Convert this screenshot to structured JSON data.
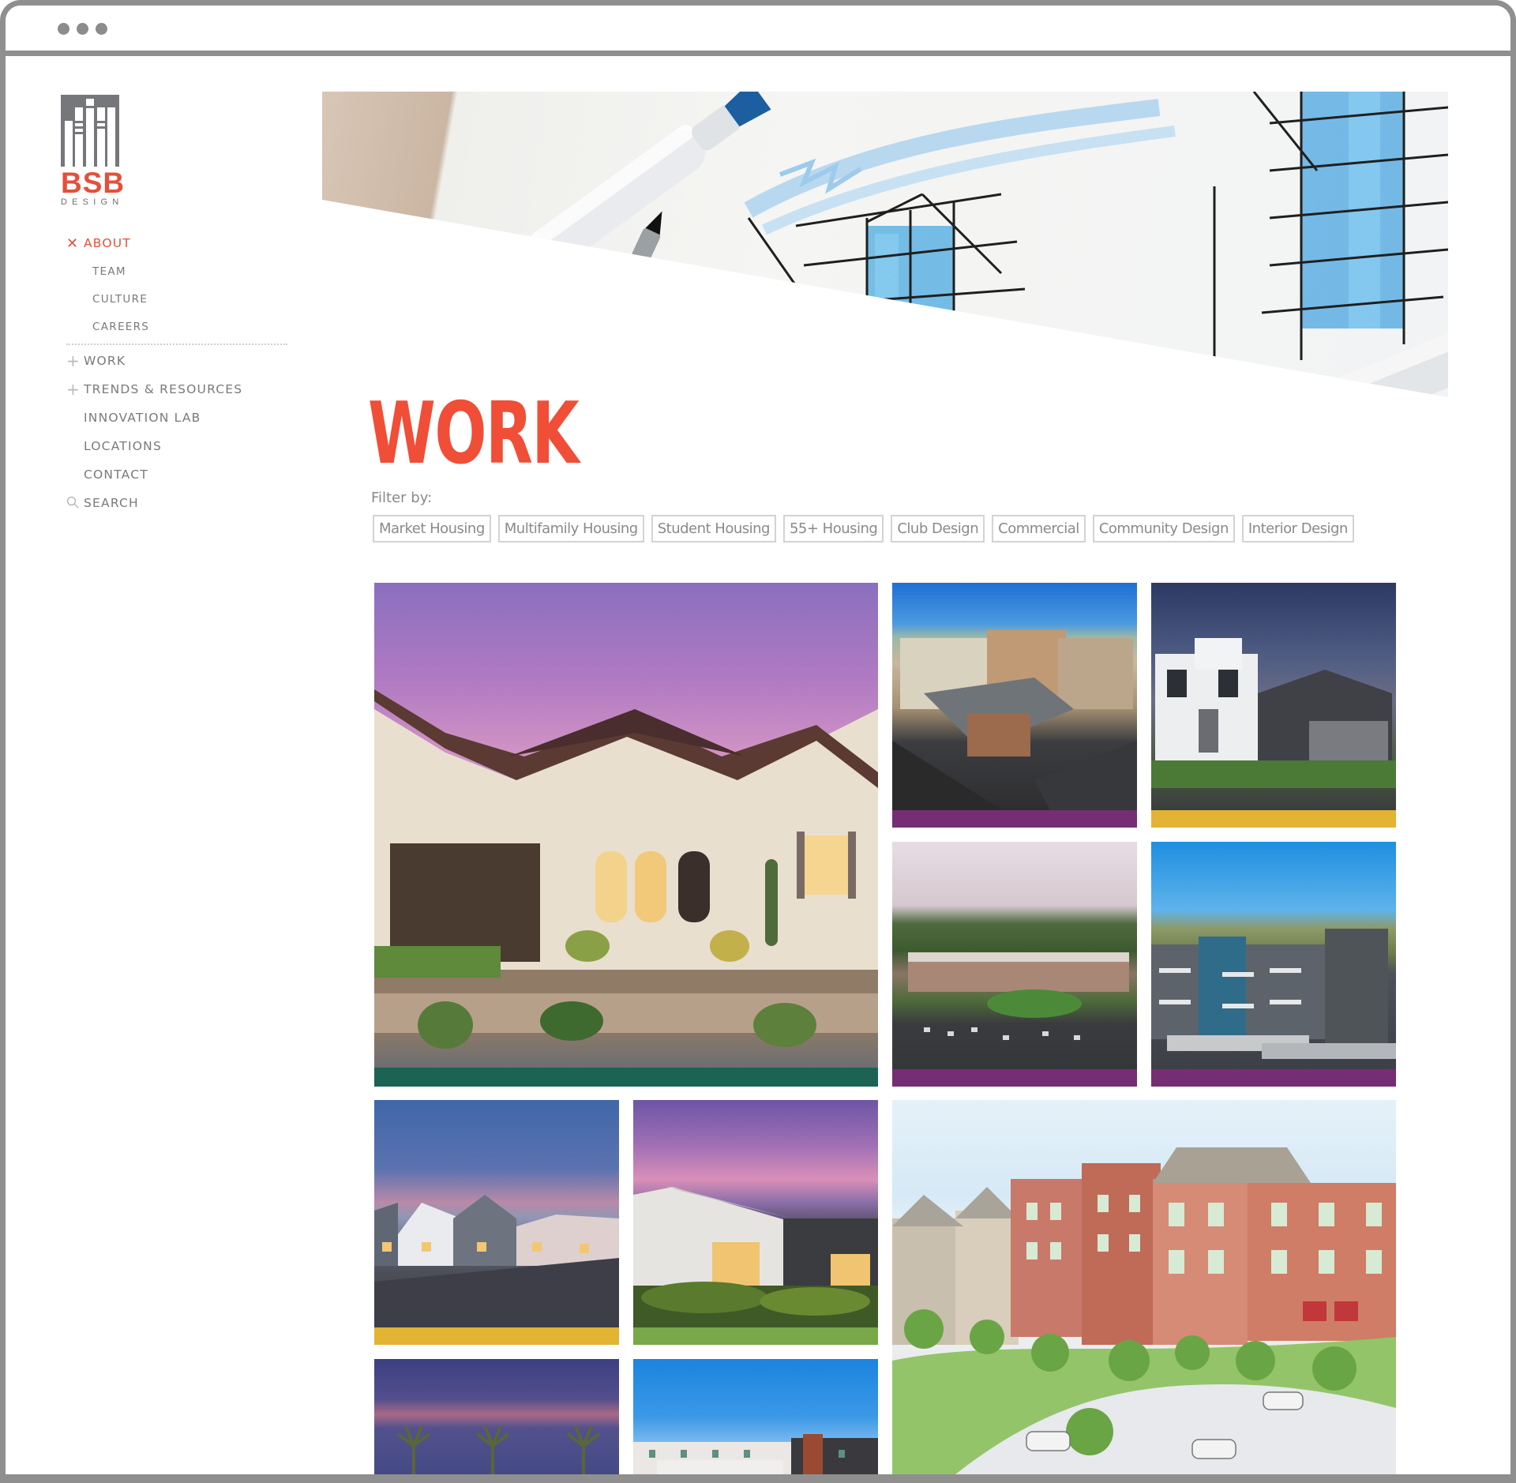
{
  "window": {
    "dots": 3,
    "frame_color": "#8f8f8f"
  },
  "brand": {
    "name": "BSB",
    "sub": "DESIGN",
    "accent": "#e4503a",
    "mark_color": "#75777b"
  },
  "nav": {
    "items": [
      {
        "label": "ABOUT",
        "icon": "close-icon",
        "glyph": "✕",
        "active": true,
        "children": [
          {
            "label": "TEAM"
          },
          {
            "label": "CULTURE"
          },
          {
            "label": "CAREERS"
          }
        ]
      },
      {
        "label": "WORK",
        "icon": "plus-icon",
        "glyph": "+"
      },
      {
        "label": "TRENDS & RESOURCES",
        "icon": "plus-icon",
        "glyph": "+"
      },
      {
        "label": "INNOVATION LAB"
      },
      {
        "label": "LOCATIONS"
      },
      {
        "label": "CONTACT"
      },
      {
        "label": "SEARCH",
        "icon": "search-icon"
      }
    ]
  },
  "hero": {
    "alt": "Architectural sketch with Copic sketch markers"
  },
  "page": {
    "title": "WORK",
    "title_color": "#f04e37",
    "filter_label": "Filter by:",
    "filters": [
      "Market Housing",
      "Multifamily Housing",
      "Student Housing",
      "55+ Housing",
      "Club Design",
      "Commercial",
      "Community Design",
      "Interior Design"
    ]
  },
  "category_colors": {
    "market_housing": "#1b6453",
    "multifamily": "#752e74",
    "55_plus": "#e3b334",
    "club": "#77a84a"
  },
  "projects": [
    {
      "name": "Desert single-family home at dusk",
      "bar": "#1b6453"
    },
    {
      "name": "Aerial multifamily community",
      "bar": "#752e74"
    },
    {
      "name": "Two-story stucco home",
      "bar": "#e3b334"
    },
    {
      "name": "Aerial apartment campus",
      "bar": "#752e74"
    },
    {
      "name": "Mountain-view apartments",
      "bar": "#752e74"
    },
    {
      "name": "Street of modern homes at dusk",
      "bar": "#e3b334"
    },
    {
      "name": "Clubhouse at twilight",
      "bar": "#77a84a"
    },
    {
      "name": "Mixed-use town center rendering",
      "bar": ""
    },
    {
      "name": "Palm trees at dusk",
      "bar": ""
    },
    {
      "name": "Modern apartment buildings",
      "bar": ""
    }
  ]
}
